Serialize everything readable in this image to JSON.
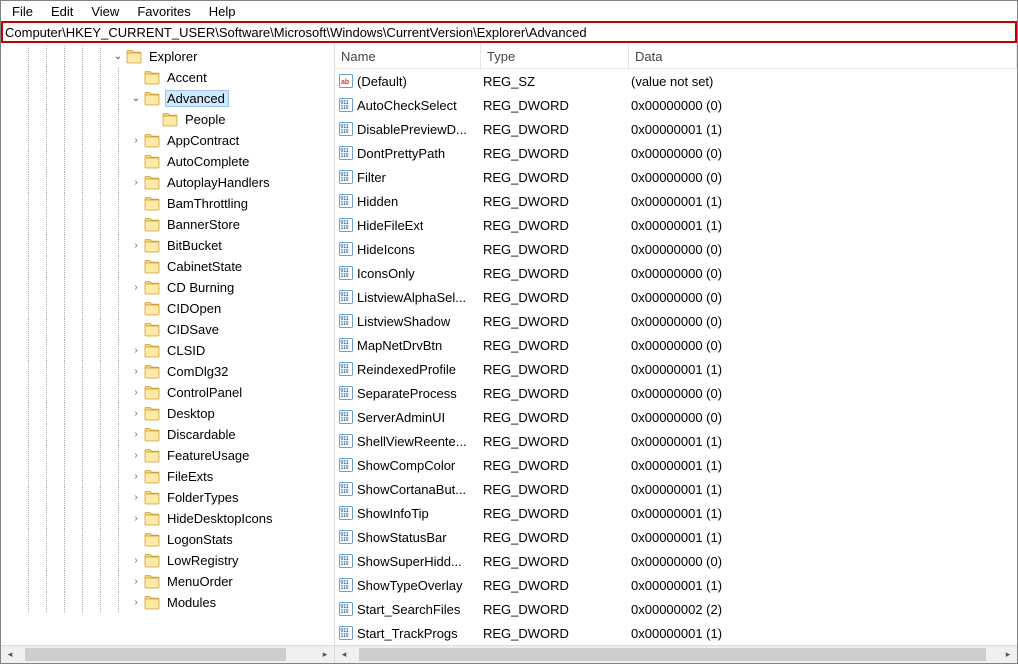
{
  "menubar": [
    "File",
    "Edit",
    "View",
    "Favorites",
    "Help"
  ],
  "address": "Computer\\HKEY_CURRENT_USER\\Software\\Microsoft\\Windows\\CurrentVersion\\Explorer\\Advanced",
  "tree": [
    {
      "depth": 6,
      "expander": "open",
      "label": "Explorer",
      "selected": false
    },
    {
      "depth": 7,
      "expander": "none",
      "label": "Accent",
      "selected": false
    },
    {
      "depth": 7,
      "expander": "open",
      "label": "Advanced",
      "selected": true
    },
    {
      "depth": 8,
      "expander": "none",
      "label": "People",
      "selected": false
    },
    {
      "depth": 7,
      "expander": "closed",
      "label": "AppContract",
      "selected": false
    },
    {
      "depth": 7,
      "expander": "none",
      "label": "AutoComplete",
      "selected": false
    },
    {
      "depth": 7,
      "expander": "closed",
      "label": "AutoplayHandlers",
      "selected": false
    },
    {
      "depth": 7,
      "expander": "none",
      "label": "BamThrottling",
      "selected": false
    },
    {
      "depth": 7,
      "expander": "none",
      "label": "BannerStore",
      "selected": false
    },
    {
      "depth": 7,
      "expander": "closed",
      "label": "BitBucket",
      "selected": false
    },
    {
      "depth": 7,
      "expander": "none",
      "label": "CabinetState",
      "selected": false
    },
    {
      "depth": 7,
      "expander": "closed",
      "label": "CD Burning",
      "selected": false
    },
    {
      "depth": 7,
      "expander": "none",
      "label": "CIDOpen",
      "selected": false
    },
    {
      "depth": 7,
      "expander": "none",
      "label": "CIDSave",
      "selected": false
    },
    {
      "depth": 7,
      "expander": "closed",
      "label": "CLSID",
      "selected": false
    },
    {
      "depth": 7,
      "expander": "closed",
      "label": "ComDlg32",
      "selected": false
    },
    {
      "depth": 7,
      "expander": "closed",
      "label": "ControlPanel",
      "selected": false
    },
    {
      "depth": 7,
      "expander": "closed",
      "label": "Desktop",
      "selected": false
    },
    {
      "depth": 7,
      "expander": "closed",
      "label": "Discardable",
      "selected": false
    },
    {
      "depth": 7,
      "expander": "closed",
      "label": "FeatureUsage",
      "selected": false
    },
    {
      "depth": 7,
      "expander": "closed",
      "label": "FileExts",
      "selected": false
    },
    {
      "depth": 7,
      "expander": "closed",
      "label": "FolderTypes",
      "selected": false
    },
    {
      "depth": 7,
      "expander": "closed",
      "label": "HideDesktopIcons",
      "selected": false
    },
    {
      "depth": 7,
      "expander": "none",
      "label": "LogonStats",
      "selected": false
    },
    {
      "depth": 7,
      "expander": "closed",
      "label": "LowRegistry",
      "selected": false
    },
    {
      "depth": 7,
      "expander": "closed",
      "label": "MenuOrder",
      "selected": false
    },
    {
      "depth": 7,
      "expander": "closed",
      "label": "Modules",
      "selected": false
    }
  ],
  "list_headers": {
    "name": "Name",
    "type": "Type",
    "data": "Data"
  },
  "values": [
    {
      "icon": "sz",
      "name": "(Default)",
      "type": "REG_SZ",
      "data": "(value not set)"
    },
    {
      "icon": "dw",
      "name": "AutoCheckSelect",
      "type": "REG_DWORD",
      "data": "0x00000000 (0)"
    },
    {
      "icon": "dw",
      "name": "DisablePreviewD...",
      "type": "REG_DWORD",
      "data": "0x00000001 (1)"
    },
    {
      "icon": "dw",
      "name": "DontPrettyPath",
      "type": "REG_DWORD",
      "data": "0x00000000 (0)"
    },
    {
      "icon": "dw",
      "name": "Filter",
      "type": "REG_DWORD",
      "data": "0x00000000 (0)"
    },
    {
      "icon": "dw",
      "name": "Hidden",
      "type": "REG_DWORD",
      "data": "0x00000001 (1)"
    },
    {
      "icon": "dw",
      "name": "HideFileExt",
      "type": "REG_DWORD",
      "data": "0x00000001 (1)"
    },
    {
      "icon": "dw",
      "name": "HideIcons",
      "type": "REG_DWORD",
      "data": "0x00000000 (0)"
    },
    {
      "icon": "dw",
      "name": "IconsOnly",
      "type": "REG_DWORD",
      "data": "0x00000000 (0)"
    },
    {
      "icon": "dw",
      "name": "ListviewAlphaSel...",
      "type": "REG_DWORD",
      "data": "0x00000000 (0)"
    },
    {
      "icon": "dw",
      "name": "ListviewShadow",
      "type": "REG_DWORD",
      "data": "0x00000000 (0)"
    },
    {
      "icon": "dw",
      "name": "MapNetDrvBtn",
      "type": "REG_DWORD",
      "data": "0x00000000 (0)"
    },
    {
      "icon": "dw",
      "name": "ReindexedProfile",
      "type": "REG_DWORD",
      "data": "0x00000001 (1)"
    },
    {
      "icon": "dw",
      "name": "SeparateProcess",
      "type": "REG_DWORD",
      "data": "0x00000000 (0)"
    },
    {
      "icon": "dw",
      "name": "ServerAdminUI",
      "type": "REG_DWORD",
      "data": "0x00000000 (0)"
    },
    {
      "icon": "dw",
      "name": "ShellViewReente...",
      "type": "REG_DWORD",
      "data": "0x00000001 (1)"
    },
    {
      "icon": "dw",
      "name": "ShowCompColor",
      "type": "REG_DWORD",
      "data": "0x00000001 (1)"
    },
    {
      "icon": "dw",
      "name": "ShowCortanaBut...",
      "type": "REG_DWORD",
      "data": "0x00000001 (1)"
    },
    {
      "icon": "dw",
      "name": "ShowInfoTip",
      "type": "REG_DWORD",
      "data": "0x00000001 (1)"
    },
    {
      "icon": "dw",
      "name": "ShowStatusBar",
      "type": "REG_DWORD",
      "data": "0x00000001 (1)"
    },
    {
      "icon": "dw",
      "name": "ShowSuperHidd...",
      "type": "REG_DWORD",
      "data": "0x00000000 (0)"
    },
    {
      "icon": "dw",
      "name": "ShowTypeOverlay",
      "type": "REG_DWORD",
      "data": "0x00000001 (1)"
    },
    {
      "icon": "dw",
      "name": "Start_SearchFiles",
      "type": "REG_DWORD",
      "data": "0x00000002 (2)"
    },
    {
      "icon": "dw",
      "name": "Start_TrackProgs",
      "type": "REG_DWORD",
      "data": "0x00000001 (1)"
    }
  ],
  "tree_hscroll": {
    "thumb_left_pct": 2,
    "thumb_width_pct": 88
  },
  "list_hscroll": {
    "thumb_left_pct": 1,
    "thumb_width_pct": 97
  }
}
